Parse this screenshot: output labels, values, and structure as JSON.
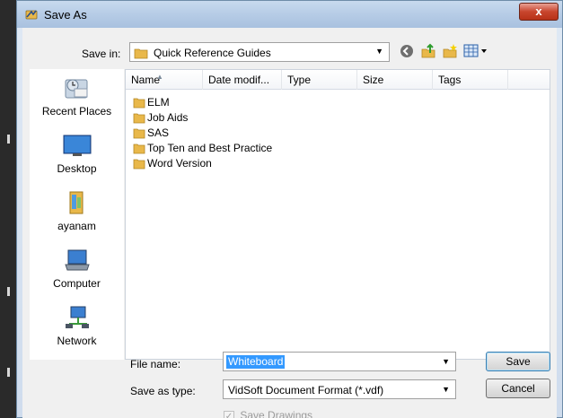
{
  "window": {
    "title": "Save As",
    "close_glyph": "x"
  },
  "save_in": {
    "label": "Save in:",
    "value": "Quick Reference Guides"
  },
  "toolbar": {
    "icons": [
      "back-icon",
      "up-folder-icon",
      "new-folder-icon",
      "views-menu-icon"
    ]
  },
  "places": [
    {
      "label": "Recent Places",
      "icon": "recent-places-icon"
    },
    {
      "label": "Desktop",
      "icon": "desktop-icon"
    },
    {
      "label": "ayanam",
      "icon": "user-folder-icon"
    },
    {
      "label": "Computer",
      "icon": "computer-icon"
    },
    {
      "label": "Network",
      "icon": "network-icon"
    }
  ],
  "columns": [
    "Name",
    "Date modif...",
    "Type",
    "Size",
    "Tags"
  ],
  "files": [
    {
      "name": "ELM"
    },
    {
      "name": "Job Aids"
    },
    {
      "name": "SAS"
    },
    {
      "name": "Top Ten and Best Practice"
    },
    {
      "name": "Word Version"
    }
  ],
  "file_name": {
    "label": "File name:",
    "value": "Whiteboard"
  },
  "save_as_type": {
    "label": "Save as type:",
    "value": "VidSoft Document Format (*.vdf)"
  },
  "buttons": {
    "save": "Save",
    "cancel": "Cancel"
  },
  "save_drawings": {
    "label": "Save Drawings",
    "checked": true,
    "enabled": false
  },
  "colors": {
    "folder": "#e9b84a",
    "selection": "#3399ff",
    "close": "#c8452d"
  }
}
